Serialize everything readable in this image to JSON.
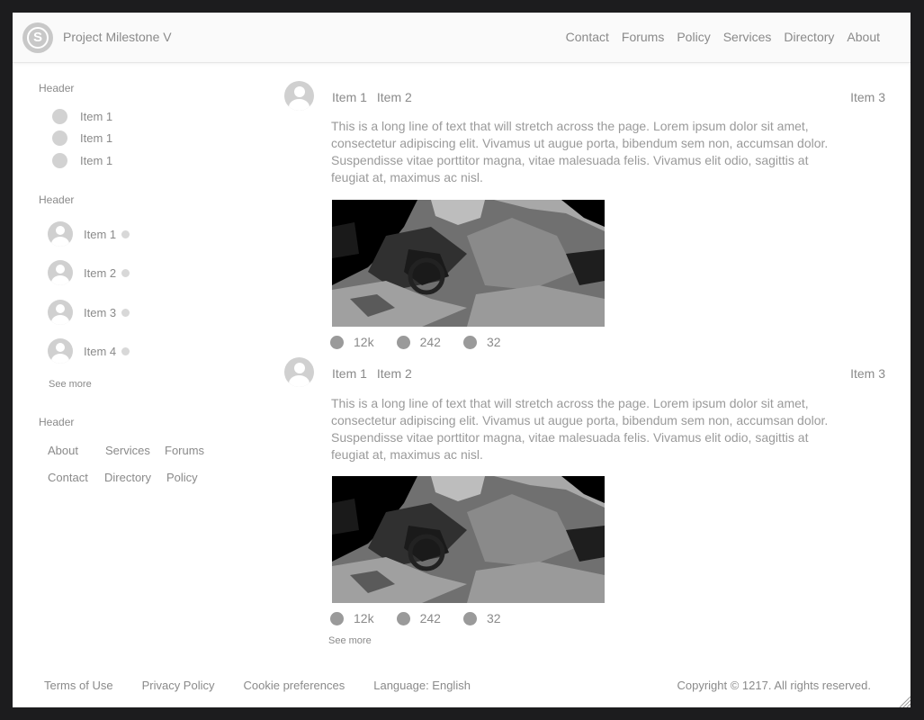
{
  "app": {
    "logo_letter": "S",
    "title": "Project Milestone V"
  },
  "nav": [
    "Contact",
    "Forums",
    "Policy",
    "Services",
    "Directory",
    "About"
  ],
  "sidebar": {
    "section1": {
      "header": "Header",
      "items": [
        "Item 1",
        "Item 1",
        "Item 1"
      ]
    },
    "section2": {
      "header": "Header",
      "items": [
        "Item 1",
        "Item 2",
        "Item 3",
        "Item 4"
      ],
      "see_more": "See more"
    },
    "section3": {
      "header": "Header",
      "links": [
        [
          "About",
          "Services",
          "Forums"
        ],
        [
          "Contact",
          "Directory",
          "Policy"
        ]
      ]
    }
  },
  "posts": [
    {
      "meta_left": [
        "Item 1",
        "Item 2"
      ],
      "meta_right": "Item 3",
      "text": "This is a long line of text that will stretch across the page. Lorem ipsum dolor sit amet, consectetur adipiscing elit. Vivamus ut augue porta, bibendum sem non, accumsan dolor. Suspendisse vitae porttitor magna, vitae malesuada felis. Vivamus elit odio, sagittis at feugiat at, maximus ac nisl.",
      "stats": [
        "12k",
        "242",
        "32"
      ]
    },
    {
      "meta_left": [
        "Item 1",
        "Item 2"
      ],
      "meta_right": "Item 3",
      "text": "This is a long line of text that will stretch across the page. Lorem ipsum dolor sit amet, consectetur adipiscing elit. Vivamus ut augue porta, bibendum sem non, accumsan dolor. Suspendisse vitae porttitor magna, vitae malesuada felis. Vivamus elit odio, sagittis at feugiat at, maximus ac nisl.",
      "stats": [
        "12k",
        "242",
        "32"
      ]
    }
  ],
  "feed": {
    "see_more": "See more"
  },
  "footer": {
    "links": [
      "Terms of Use",
      "Privacy Policy",
      "Cookie preferences",
      "Language: English"
    ],
    "copyright": "Copyright © 1217. All rights reserved."
  },
  "colors": {
    "background": "#1c1c1e",
    "surface": "#ffffff",
    "text": "#8a8a8a",
    "placeholder": "#d0d0d0"
  }
}
